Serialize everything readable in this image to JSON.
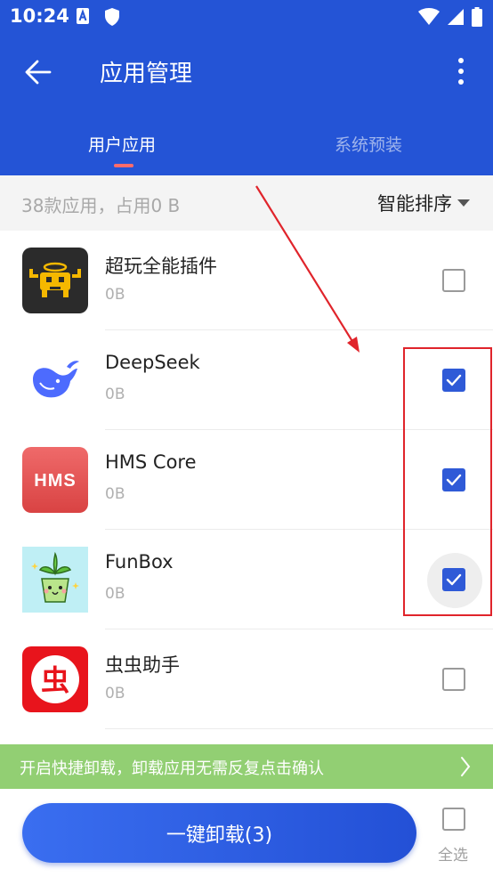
{
  "status_bar": {
    "time": "10:24",
    "icons": [
      "a-icon",
      "shield-icon",
      "wifi-icon",
      "signal-icon",
      "battery-icon"
    ]
  },
  "toolbar": {
    "title": "应用管理",
    "back_icon": "arrow-left-icon",
    "more_icon": "more-vertical-icon"
  },
  "tabs": [
    {
      "label": "用户应用",
      "active": true
    },
    {
      "label": "系统预装",
      "active": false
    }
  ],
  "summary": {
    "text": "38款应用，占用0 B",
    "sort_label": "智能排序"
  },
  "apps": [
    {
      "name": "超玩全能插件",
      "size": "0B",
      "checked": false,
      "icon": "crab-robot-icon"
    },
    {
      "name": "DeepSeek",
      "size": "0B",
      "checked": true,
      "icon": "whale-icon"
    },
    {
      "name": "HMS Core",
      "size": "0B",
      "checked": true,
      "icon": "hms-logo-icon"
    },
    {
      "name": "FunBox",
      "size": "0B",
      "checked": true,
      "icon": "potted-plant-icon"
    },
    {
      "name": "虫虫助手",
      "size": "0B",
      "checked": false,
      "icon": "chong-logo-icon"
    }
  ],
  "hms_logo_text": "HMS",
  "chong_logo_text": "虫",
  "promo": {
    "text": "开启快捷卸载，卸载应用无需反复点击确认"
  },
  "bottom": {
    "uninstall_label": "一键卸载(3)",
    "select_all_label": "全选"
  },
  "colors": {
    "header_bg": "#2454d6",
    "checkbox_checked": "#2f5ad7",
    "promo_bg": "#92cf73",
    "annotation_red": "#e0242b",
    "tab_indicator": "#ff6b6b"
  }
}
